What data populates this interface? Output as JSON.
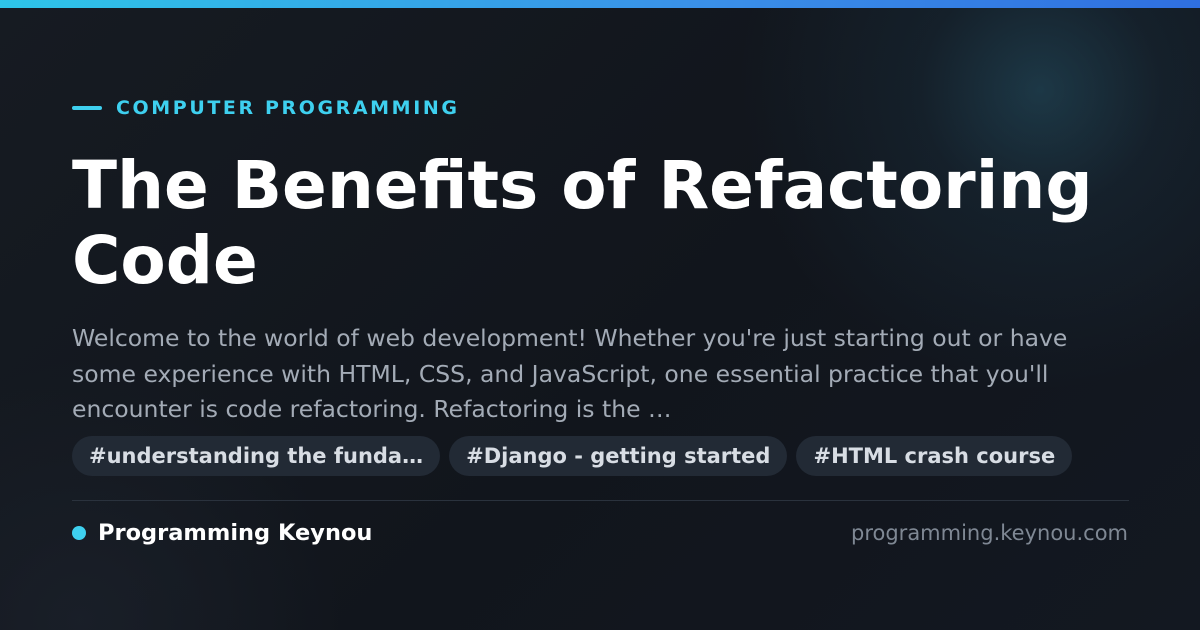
{
  "category": "COMPUTER PROGRAMMING",
  "title": "The Benefits of Refactoring Code",
  "excerpt": "Welcome to the world of web development! Whether you're just starting out or have some experience with HTML, CSS, and JavaScript, one essential practice that you'll encounter is code refactoring. Refactoring is the …",
  "tags": [
    "#understanding the funda…",
    "#Django - getting started",
    "#HTML crash course"
  ],
  "brand": {
    "name": "Programming Keynou",
    "url": "programming.keynou.com"
  },
  "colors": {
    "accent": "#3ed0ef",
    "background": "#141820",
    "top_bar_start": "#2ec5e8",
    "top_bar_end": "#2f6fe0"
  }
}
